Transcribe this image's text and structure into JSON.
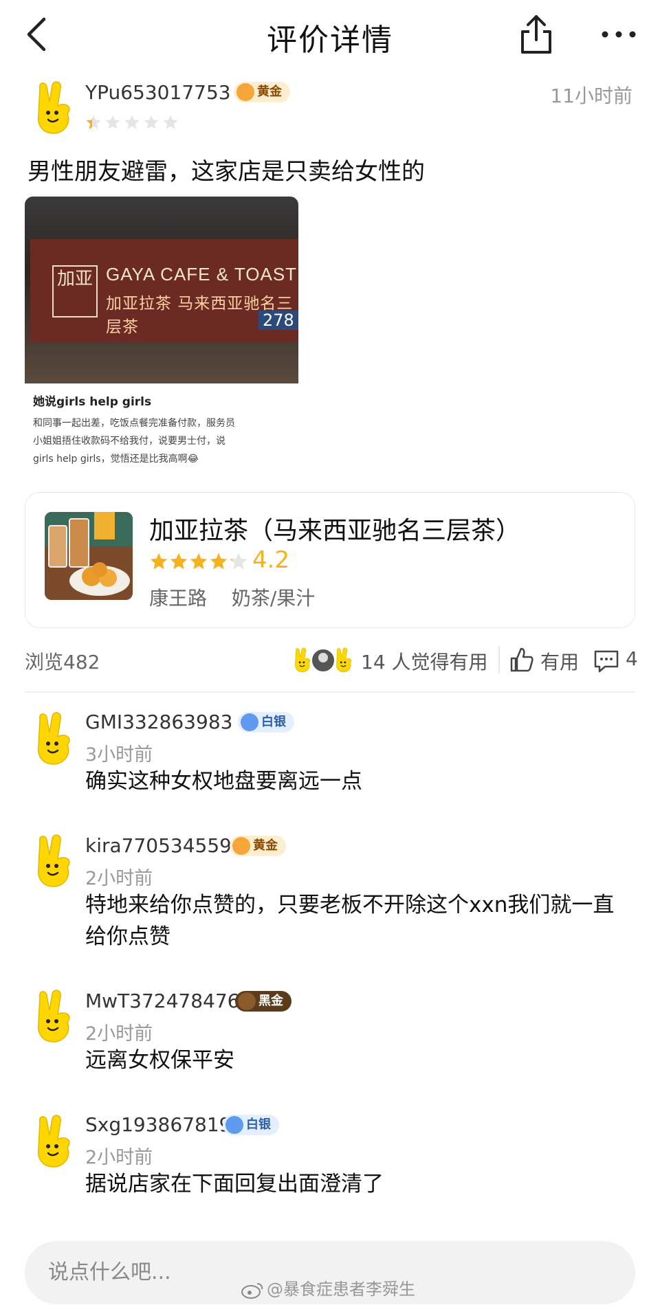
{
  "nav": {
    "title": "评价详情"
  },
  "review": {
    "username": "YPu653017753",
    "badge": "黄金",
    "time": "11小时前",
    "rating": 1,
    "text": "男性朋友避雷，这家店是只卖给女性的",
    "image": {
      "sign_en": "GAYA CAFE & TOAST",
      "sign_cn": "加亚拉茶 马来西亚驰名三层茶",
      "sign_logo": "加亚",
      "sign_number": "278",
      "shot_title": "她说girls help girls",
      "shot_line1": "和同事一起出差，吃饭点餐完准备付款，服务员",
      "shot_line2": "小姐姐捂住收款码不给我付，说要男士付，说",
      "shot_line3": "girls help girls，觉悟还是比我高啊😂"
    }
  },
  "shop": {
    "name": "加亚拉茶（马来西亚驰名三层茶）",
    "rating": 4.2,
    "score_label": "4.2",
    "location": "康王路",
    "category": "奶茶/果汁"
  },
  "stats": {
    "views": "浏览482",
    "helpful": "14 人觉得有用",
    "like_label": "有用",
    "comment_count": "4"
  },
  "comments": [
    {
      "user": "GMI332863983",
      "badge": "白银",
      "time": "3小时前",
      "text": "确实这种女权地盘要离远一点"
    },
    {
      "user": "kira770534559",
      "badge": "黄金",
      "time": "2小时前",
      "text": "特地来给你点赞的，只要老板不开除这个xxn我们就一直给你点赞"
    },
    {
      "user": "MwT372478476",
      "badge": "黑金",
      "time": "2小时前",
      "text": "远离女权保平安"
    },
    {
      "user": "Sxg193867819",
      "badge": "白银",
      "time": "2小时前",
      "text": "据说店家在下面回复出面澄清了"
    }
  ],
  "input": {
    "placeholder": "说点什么吧..."
  },
  "watermark": "@暴食症患者李舜生",
  "colors": {
    "star": "#f6b21e",
    "star_empty": "#e5e5e5",
    "avatar": "#ffd600"
  }
}
